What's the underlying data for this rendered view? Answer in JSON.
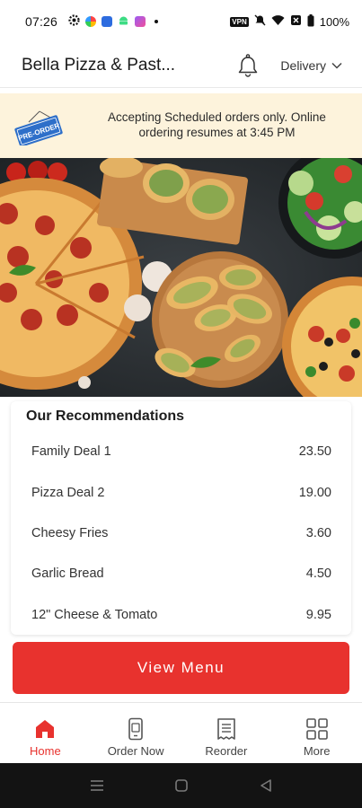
{
  "status_bar": {
    "time": "07:26",
    "vpn": "VPN",
    "battery": "100%"
  },
  "header": {
    "title": "Bella Pizza & Past...",
    "mode_label": "Delivery"
  },
  "banner": {
    "tag": "PRE-ORDER",
    "message": "Accepting Scheduled orders only. Online ordering resumes at 3:45 PM"
  },
  "recommendations": {
    "title": "Our Recommendations",
    "items": [
      {
        "name": "Family Deal 1",
        "price": "23.50"
      },
      {
        "name": "Pizza Deal 2",
        "price": "19.00"
      },
      {
        "name": "Cheesy Fries",
        "price": "3.60"
      },
      {
        "name": "Garlic Bread",
        "price": "4.50"
      },
      {
        "name": "12\" Cheese & Tomato",
        "price": "9.95"
      }
    ]
  },
  "cta": {
    "label": "View Menu"
  },
  "bottom_nav": {
    "items": [
      {
        "label": "Home",
        "icon": "home-icon",
        "active": true
      },
      {
        "label": "Order Now",
        "icon": "phone-order-icon",
        "active": false
      },
      {
        "label": "Reorder",
        "icon": "receipt-icon",
        "active": false
      },
      {
        "label": "More",
        "icon": "grid-icon",
        "active": false
      }
    ]
  },
  "colors": {
    "brand_red": "#e8322e",
    "banner_bg": "#fdf3dc",
    "tag_blue": "#2e6fc9"
  }
}
